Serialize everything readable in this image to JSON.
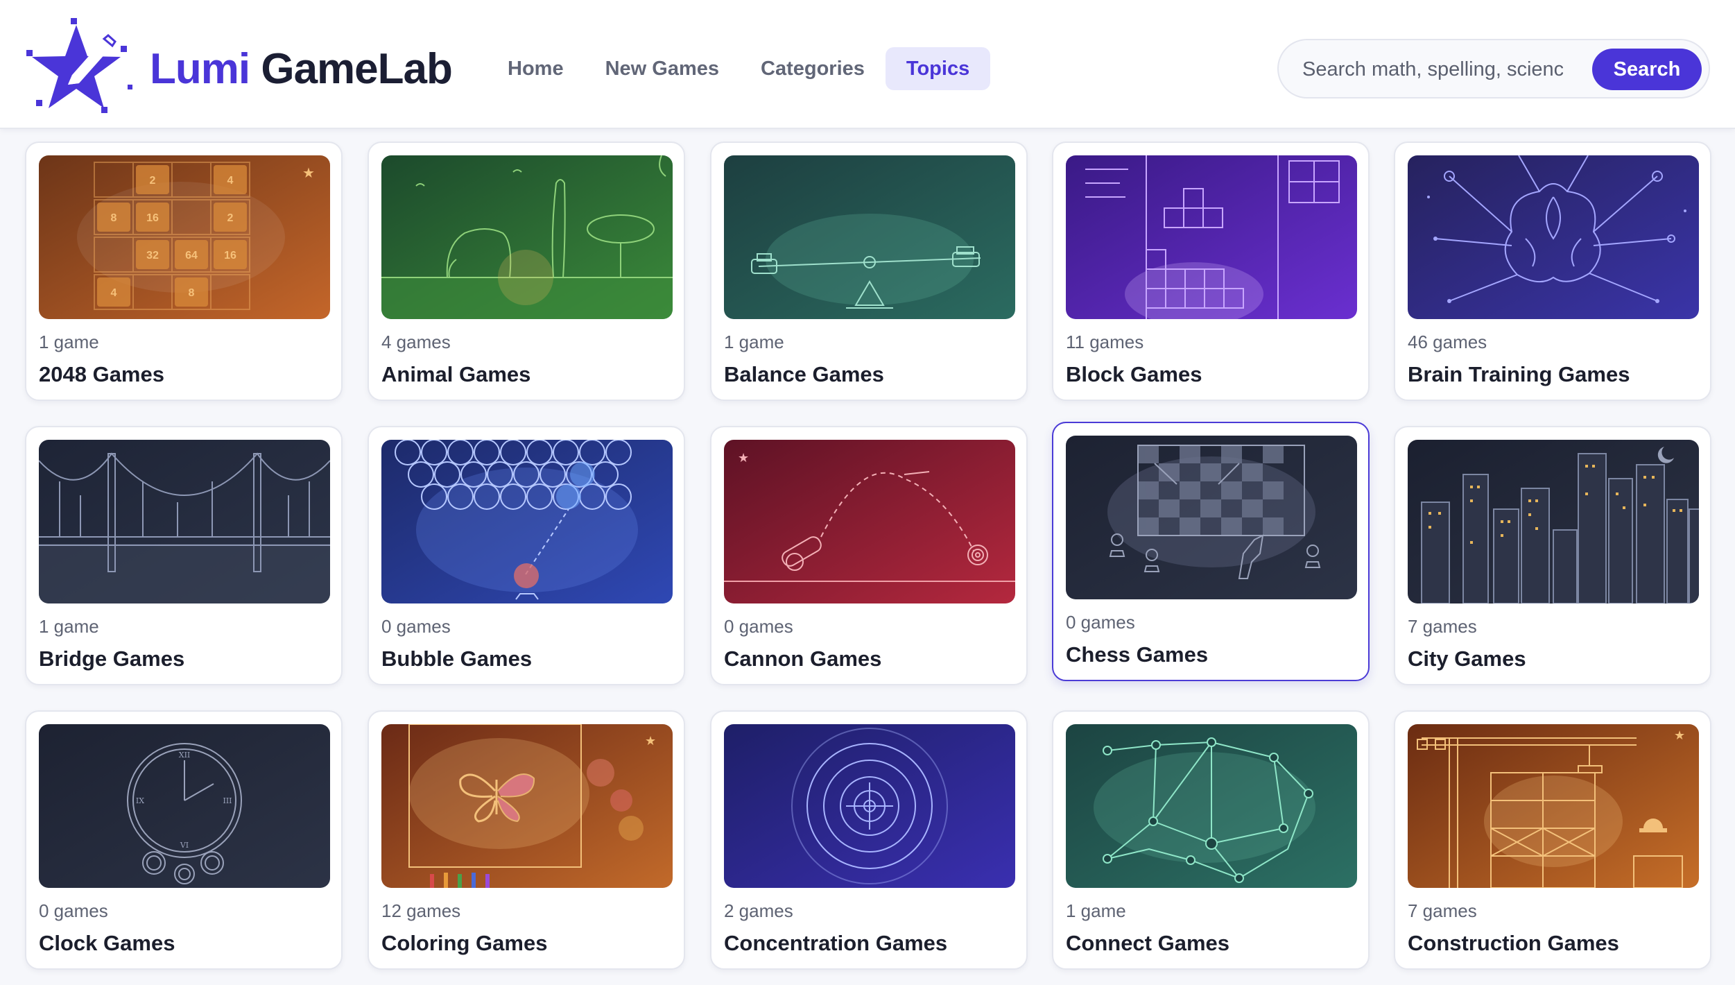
{
  "brand": {
    "part1": "Lumi",
    "part2": "GameLab"
  },
  "nav": [
    {
      "label": "Home",
      "active": false
    },
    {
      "label": "New Games",
      "active": false
    },
    {
      "label": "Categories",
      "active": false
    },
    {
      "label": "Topics",
      "active": true
    }
  ],
  "search": {
    "placeholder": "Search math, spelling, science",
    "button_label": "Search"
  },
  "colors": {
    "accent": "#4a35d8",
    "active_tab_bg": "#e8e8fc"
  },
  "topics": [
    {
      "count": "1 game",
      "title": "2048 Games",
      "icon": "2048-grid-icon"
    },
    {
      "count": "4 games",
      "title": "Animal Games",
      "icon": "animals-icon"
    },
    {
      "count": "1 game",
      "title": "Balance Games",
      "icon": "seesaw-icon"
    },
    {
      "count": "11 games",
      "title": "Block Games",
      "icon": "blocks-icon"
    },
    {
      "count": "46 games",
      "title": "Brain Training Games",
      "icon": "brain-icon"
    },
    {
      "count": "1 game",
      "title": "Bridge Games",
      "icon": "bridge-icon"
    },
    {
      "count": "0 games",
      "title": "Bubble Games",
      "icon": "bubbles-icon"
    },
    {
      "count": "0 games",
      "title": "Cannon Games",
      "icon": "cannon-icon"
    },
    {
      "count": "0 games",
      "title": "Chess Games",
      "icon": "chessboard-icon"
    },
    {
      "count": "7 games",
      "title": "City Games",
      "icon": "city-skyline-icon"
    },
    {
      "count": "0 games",
      "title": "Clock Games",
      "icon": "clock-icon"
    },
    {
      "count": "12 games",
      "title": "Coloring Games",
      "icon": "butterfly-icon"
    },
    {
      "count": "2 games",
      "title": "Concentration Games",
      "icon": "target-icon"
    },
    {
      "count": "1 game",
      "title": "Connect Games",
      "icon": "network-icon"
    },
    {
      "count": "7 games",
      "title": "Construction Games",
      "icon": "crane-icon"
    }
  ]
}
